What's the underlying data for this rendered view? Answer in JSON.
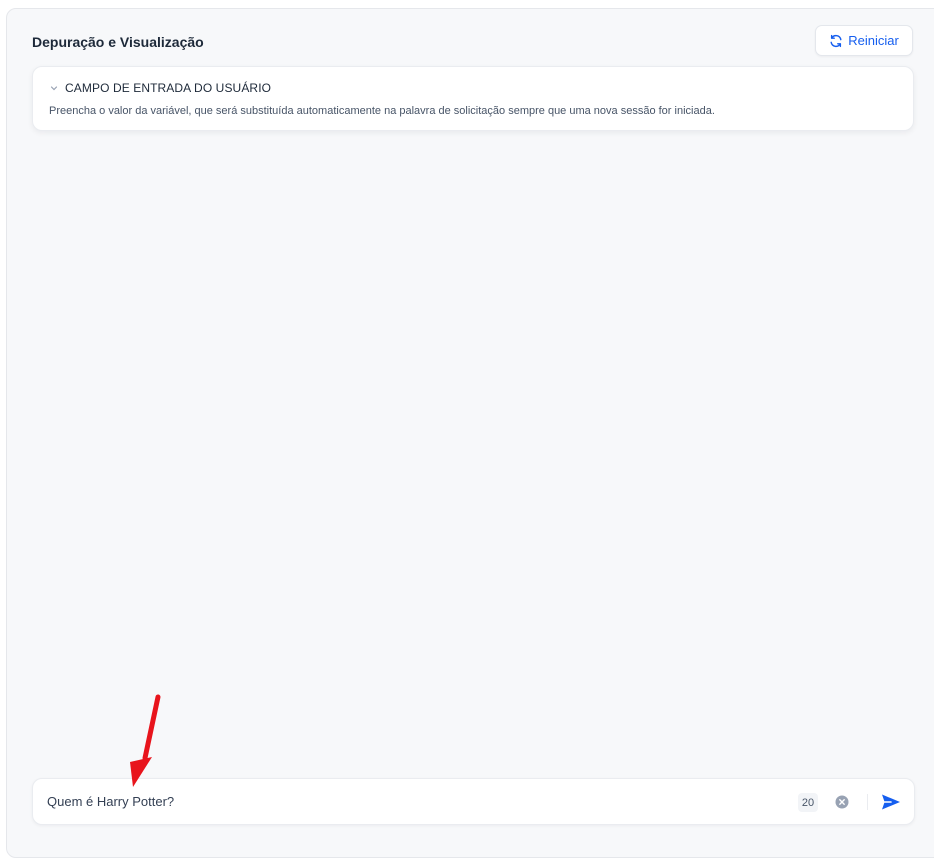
{
  "header": {
    "title": "Depuração e Visualização",
    "restart_label": "Reiniciar"
  },
  "user_input_card": {
    "title": "CAMPO DE ENTRADA DO USUÁRIO",
    "description": "Preencha o valor da variável, que será substituída automaticamente na palavra de solicitação sempre que uma nova sessão for iniciada."
  },
  "chat_input": {
    "value": "Quem é Harry Potter?",
    "char_count": "20"
  },
  "icons": {
    "restart": "refresh-icon",
    "collapse": "chevron-down-icon",
    "clear": "clear-circle-icon",
    "send": "send-icon",
    "annotation": "red-arrow-annotation"
  },
  "colors": {
    "accent": "#155eef",
    "annotation": "#e8141c",
    "panel_bg": "#f7f8fa"
  }
}
